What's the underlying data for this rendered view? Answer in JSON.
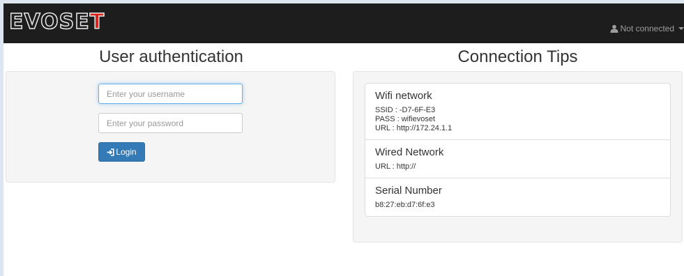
{
  "brand": {
    "logo_main": "EVOSE",
    "logo_accent": "T",
    "accent_color": "#d9231d"
  },
  "navbar": {
    "status_text": "Not connected",
    "status_icon": "user-icon"
  },
  "auth": {
    "title": "User authentication",
    "username_placeholder": "Enter your username",
    "password_placeholder": "Enter your password",
    "login_label": "Login",
    "login_icon": "login-icon",
    "button_color": "#337ab7"
  },
  "tips": {
    "title": "Connection Tips",
    "items": [
      {
        "title": "Wifi network",
        "lines": [
          "SSID : -D7-6F-E3",
          "PASS : wifievoset",
          "URL : http://172.24.1.1"
        ]
      },
      {
        "title": "Wired Network",
        "lines": [
          "URL : http://"
        ]
      },
      {
        "title": "Serial Number",
        "lines": [
          "b8:27:eb:d7:6f:e3"
        ]
      }
    ]
  }
}
